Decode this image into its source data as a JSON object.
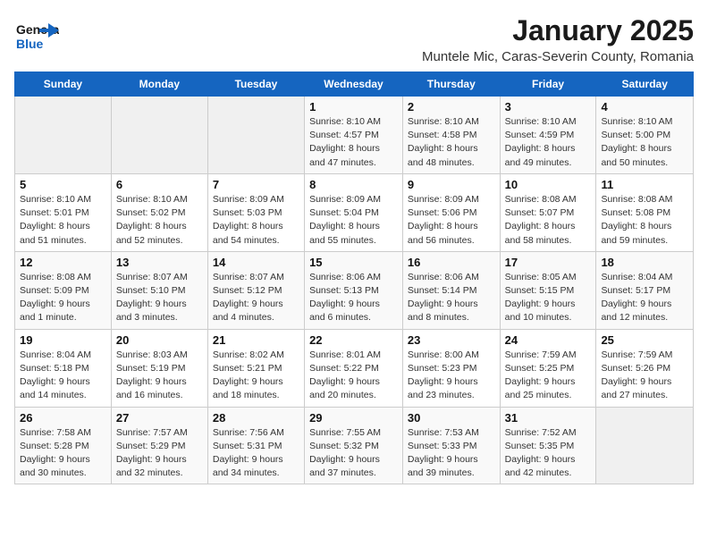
{
  "header": {
    "logo_line1": "General",
    "logo_line2": "Blue",
    "main_title": "January 2025",
    "subtitle": "Muntele Mic, Caras-Severin County, Romania"
  },
  "calendar": {
    "days_of_week": [
      "Sunday",
      "Monday",
      "Tuesday",
      "Wednesday",
      "Thursday",
      "Friday",
      "Saturday"
    ],
    "weeks": [
      [
        {
          "day": "",
          "info": ""
        },
        {
          "day": "",
          "info": ""
        },
        {
          "day": "",
          "info": ""
        },
        {
          "day": "1",
          "info": "Sunrise: 8:10 AM\nSunset: 4:57 PM\nDaylight: 8 hours\nand 47 minutes."
        },
        {
          "day": "2",
          "info": "Sunrise: 8:10 AM\nSunset: 4:58 PM\nDaylight: 8 hours\nand 48 minutes."
        },
        {
          "day": "3",
          "info": "Sunrise: 8:10 AM\nSunset: 4:59 PM\nDaylight: 8 hours\nand 49 minutes."
        },
        {
          "day": "4",
          "info": "Sunrise: 8:10 AM\nSunset: 5:00 PM\nDaylight: 8 hours\nand 50 minutes."
        }
      ],
      [
        {
          "day": "5",
          "info": "Sunrise: 8:10 AM\nSunset: 5:01 PM\nDaylight: 8 hours\nand 51 minutes."
        },
        {
          "day": "6",
          "info": "Sunrise: 8:10 AM\nSunset: 5:02 PM\nDaylight: 8 hours\nand 52 minutes."
        },
        {
          "day": "7",
          "info": "Sunrise: 8:09 AM\nSunset: 5:03 PM\nDaylight: 8 hours\nand 54 minutes."
        },
        {
          "day": "8",
          "info": "Sunrise: 8:09 AM\nSunset: 5:04 PM\nDaylight: 8 hours\nand 55 minutes."
        },
        {
          "day": "9",
          "info": "Sunrise: 8:09 AM\nSunset: 5:06 PM\nDaylight: 8 hours\nand 56 minutes."
        },
        {
          "day": "10",
          "info": "Sunrise: 8:08 AM\nSunset: 5:07 PM\nDaylight: 8 hours\nand 58 minutes."
        },
        {
          "day": "11",
          "info": "Sunrise: 8:08 AM\nSunset: 5:08 PM\nDaylight: 8 hours\nand 59 minutes."
        }
      ],
      [
        {
          "day": "12",
          "info": "Sunrise: 8:08 AM\nSunset: 5:09 PM\nDaylight: 9 hours\nand 1 minute."
        },
        {
          "day": "13",
          "info": "Sunrise: 8:07 AM\nSunset: 5:10 PM\nDaylight: 9 hours\nand 3 minutes."
        },
        {
          "day": "14",
          "info": "Sunrise: 8:07 AM\nSunset: 5:12 PM\nDaylight: 9 hours\nand 4 minutes."
        },
        {
          "day": "15",
          "info": "Sunrise: 8:06 AM\nSunset: 5:13 PM\nDaylight: 9 hours\nand 6 minutes."
        },
        {
          "day": "16",
          "info": "Sunrise: 8:06 AM\nSunset: 5:14 PM\nDaylight: 9 hours\nand 8 minutes."
        },
        {
          "day": "17",
          "info": "Sunrise: 8:05 AM\nSunset: 5:15 PM\nDaylight: 9 hours\nand 10 minutes."
        },
        {
          "day": "18",
          "info": "Sunrise: 8:04 AM\nSunset: 5:17 PM\nDaylight: 9 hours\nand 12 minutes."
        }
      ],
      [
        {
          "day": "19",
          "info": "Sunrise: 8:04 AM\nSunset: 5:18 PM\nDaylight: 9 hours\nand 14 minutes."
        },
        {
          "day": "20",
          "info": "Sunrise: 8:03 AM\nSunset: 5:19 PM\nDaylight: 9 hours\nand 16 minutes."
        },
        {
          "day": "21",
          "info": "Sunrise: 8:02 AM\nSunset: 5:21 PM\nDaylight: 9 hours\nand 18 minutes."
        },
        {
          "day": "22",
          "info": "Sunrise: 8:01 AM\nSunset: 5:22 PM\nDaylight: 9 hours\nand 20 minutes."
        },
        {
          "day": "23",
          "info": "Sunrise: 8:00 AM\nSunset: 5:23 PM\nDaylight: 9 hours\nand 23 minutes."
        },
        {
          "day": "24",
          "info": "Sunrise: 7:59 AM\nSunset: 5:25 PM\nDaylight: 9 hours\nand 25 minutes."
        },
        {
          "day": "25",
          "info": "Sunrise: 7:59 AM\nSunset: 5:26 PM\nDaylight: 9 hours\nand 27 minutes."
        }
      ],
      [
        {
          "day": "26",
          "info": "Sunrise: 7:58 AM\nSunset: 5:28 PM\nDaylight: 9 hours\nand 30 minutes."
        },
        {
          "day": "27",
          "info": "Sunrise: 7:57 AM\nSunset: 5:29 PM\nDaylight: 9 hours\nand 32 minutes."
        },
        {
          "day": "28",
          "info": "Sunrise: 7:56 AM\nSunset: 5:31 PM\nDaylight: 9 hours\nand 34 minutes."
        },
        {
          "day": "29",
          "info": "Sunrise: 7:55 AM\nSunset: 5:32 PM\nDaylight: 9 hours\nand 37 minutes."
        },
        {
          "day": "30",
          "info": "Sunrise: 7:53 AM\nSunset: 5:33 PM\nDaylight: 9 hours\nand 39 minutes."
        },
        {
          "day": "31",
          "info": "Sunrise: 7:52 AM\nSunset: 5:35 PM\nDaylight: 9 hours\nand 42 minutes."
        },
        {
          "day": "",
          "info": ""
        }
      ]
    ]
  }
}
